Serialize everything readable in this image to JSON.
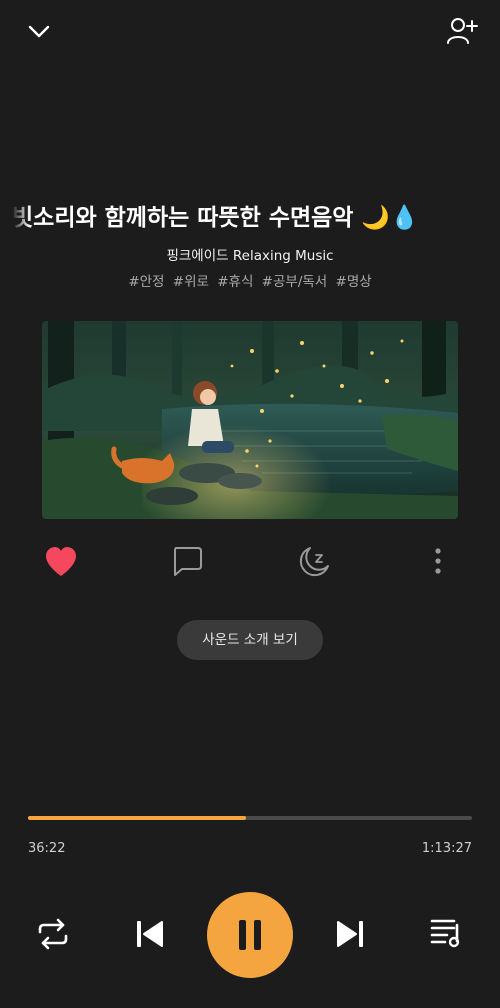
{
  "header": {
    "collapse_icon": "chevron-down-icon",
    "add_user_icon": "add-user-icon"
  },
  "track": {
    "title": "빗소리와 함께하는 따뜻한 수면음악 🌙💧",
    "artist": "핑크에이드 Relaxing Music",
    "tags": [
      "#안정",
      "#위로",
      "#휴식",
      "#공부/독서",
      "#명상"
    ]
  },
  "actions": {
    "like_icon": "heart-icon",
    "like_color": "#f5485e",
    "comment_icon": "comment-icon",
    "sleep_timer_icon": "sleep-timer-icon",
    "more_icon": "more-vertical-icon"
  },
  "intro_button": {
    "label": "사운드 소개 보기"
  },
  "playback": {
    "elapsed": "36:22",
    "duration": "1:13:27",
    "progress": 0.49,
    "accent_color": "#f5a540"
  },
  "controls": {
    "repeat_icon": "repeat-icon",
    "previous_icon": "skip-previous-icon",
    "pause_icon": "pause-icon",
    "next_icon": "skip-next-icon",
    "playlist_icon": "playlist-icon"
  }
}
